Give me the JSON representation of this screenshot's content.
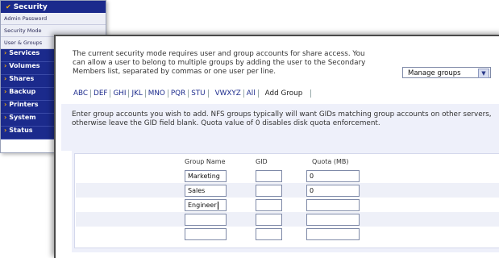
{
  "nav": {
    "header": "Security",
    "sub_items": [
      "Admin Password",
      "Security Mode",
      "User & Groups"
    ],
    "main_items": [
      "Services",
      "Volumes",
      "Shares",
      "Backup",
      "Printers",
      "System",
      "Status"
    ]
  },
  "intro_text": "The current security mode requires user and group accounts for share access. You can allow a user to belong to multiple groups by adding the user to the Secondary Members list, separated by commas or one user per line.",
  "manage_select": {
    "value": "Manage groups"
  },
  "tabs": [
    "ABC",
    "DEF",
    "GHI",
    "JKL",
    "MNO",
    "PQR",
    "STU",
    "VWXYZ",
    "All"
  ],
  "active_tab": "Add Group",
  "instructions": "Enter group accounts you wish to add. NFS groups typically will want GIDs matching group accounts on other servers, otherwise leave the GID field blank. Quota value of 0 disables disk quota enforcement.",
  "columns": {
    "name": "Group Name",
    "gid": "GID",
    "quota": "Quota (MB)"
  },
  "rows": [
    {
      "name": "Marketing",
      "gid": "",
      "quota": "0"
    },
    {
      "name": "Sales",
      "gid": "",
      "quota": "0"
    },
    {
      "name": "Engineer",
      "gid": "",
      "quota": ""
    },
    {
      "name": "",
      "gid": "",
      "quota": ""
    },
    {
      "name": "",
      "gid": "",
      "quota": ""
    }
  ]
}
